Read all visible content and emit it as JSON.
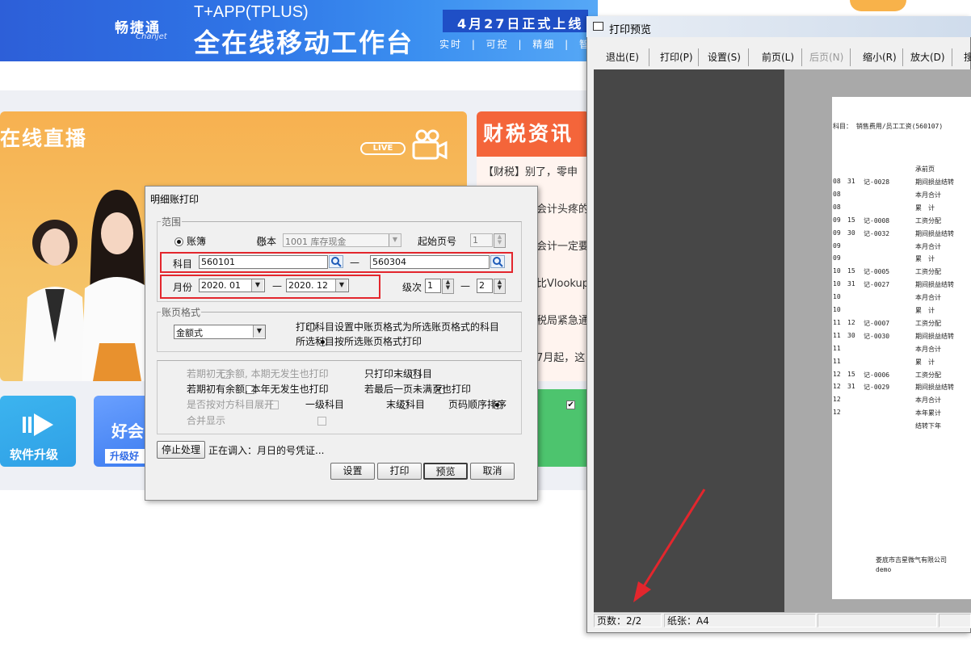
{
  "banner": {
    "logo": "畅捷通",
    "logo_sub": "Chanjet",
    "headline": "T+APP(TPLUS)",
    "title": "全在线移动工作台",
    "date": "4月27日正式上线",
    "tags": "实时 | 可控 | 精细 | 智"
  },
  "cards": {
    "live_title": "在线直播",
    "live_badge": "LIVE",
    "news_title": "财税资讯",
    "news_items": [
      "【财税】别了，零申",
      "会计头疼的",
      "会计一定要",
      "比Vlookup",
      "税局紧急通",
      "7月起，这"
    ],
    "upgrade_label": "软件升级",
    "good_a": "好会",
    "good_b": "升级好"
  },
  "dialog": {
    "title": "明细账打印",
    "range_group": "范围",
    "radio_ledger": "账簿",
    "radio_book": "账本",
    "book_value": "1001 库存现金",
    "start_page_label": "起始页号",
    "start_page_value": "1",
    "subject_label": "科目",
    "subject_from": "560101",
    "subject_to": "560304",
    "dash": "—",
    "month_label": "月份",
    "month_from": "2020. 01",
    "month_to": "2020. 12",
    "level_label": "级次",
    "level_from": "1",
    "level_to": "2",
    "format_group": "账页格式",
    "format_value": "金额式",
    "format_opt1": "打印科目设置中账页格式为所选账页格式的科目",
    "format_opt2": "所选科目按所选账页格式打印",
    "opt_no_balance": "若期初无余额, 本期无发生也打印",
    "opt_last_level": "只打印末级科目",
    "opt_has_balance": "若期初有余额, 本年无发生也打印",
    "opt_last_page": "若最后一页未满页也打印",
    "opt_expand": "是否按对方科目展开",
    "opt_level1": "一级科目",
    "opt_leaf": "末级科目",
    "opt_page_order": "页码顺序排序",
    "opt_merge": "合并显示",
    "stop_button": "停止处理",
    "status_text": "正在调入：月日的号凭证...",
    "btn_settings": "设置",
    "btn_print": "打印",
    "btn_preview": "预览",
    "btn_cancel": "取消"
  },
  "preview": {
    "title": "打印预览",
    "toolbar": {
      "exit": "退出(E)",
      "print": "打印(P)",
      "settings": "设置(S)",
      "prev": "前页(L)",
      "next": "后页(N)",
      "zoom_out": "缩小(R)",
      "zoom_in": "放大(D)",
      "more": "搜"
    },
    "page_subject": "科目：  销售费用/员工工资(560107)",
    "carry_label": "承前页",
    "rows": [
      {
        "m": "08",
        "d": "31",
        "v": "记-0028",
        "s": "期间损益结转"
      },
      {
        "m": "08",
        "d": "",
        "v": "",
        "s": "本月合计"
      },
      {
        "m": "08",
        "d": "",
        "v": "",
        "s": "累　计"
      },
      {
        "m": "09",
        "d": "15",
        "v": "记-0008",
        "s": "工资分配"
      },
      {
        "m": "09",
        "d": "30",
        "v": "记-0032",
        "s": "期间损益结转"
      },
      {
        "m": "09",
        "d": "",
        "v": "",
        "s": "本月合计"
      },
      {
        "m": "09",
        "d": "",
        "v": "",
        "s": "累　计"
      },
      {
        "m": "10",
        "d": "15",
        "v": "记-0005",
        "s": "工资分配"
      },
      {
        "m": "10",
        "d": "31",
        "v": "记-0027",
        "s": "期间损益结转"
      },
      {
        "m": "10",
        "d": "",
        "v": "",
        "s": "本月合计"
      },
      {
        "m": "10",
        "d": "",
        "v": "",
        "s": "累　计"
      },
      {
        "m": "11",
        "d": "12",
        "v": "记-0007",
        "s": "工资分配"
      },
      {
        "m": "11",
        "d": "30",
        "v": "记-0030",
        "s": "期间损益结转"
      },
      {
        "m": "11",
        "d": "",
        "v": "",
        "s": "本月合计"
      },
      {
        "m": "11",
        "d": "",
        "v": "",
        "s": "累　计"
      },
      {
        "m": "12",
        "d": "15",
        "v": "记-0006",
        "s": "工资分配"
      },
      {
        "m": "12",
        "d": "31",
        "v": "记-0029",
        "s": "期间损益结转"
      },
      {
        "m": "12",
        "d": "",
        "v": "",
        "s": "本月合计"
      },
      {
        "m": "12",
        "d": "",
        "v": "",
        "s": "本年累计"
      },
      {
        "m": "",
        "d": "",
        "v": "",
        "s": "结转下年"
      }
    ],
    "company": "娄底市吉星微气有限公司",
    "user": "demo",
    "status_pages": "页数：2/2",
    "status_paper": "纸张：A4"
  }
}
